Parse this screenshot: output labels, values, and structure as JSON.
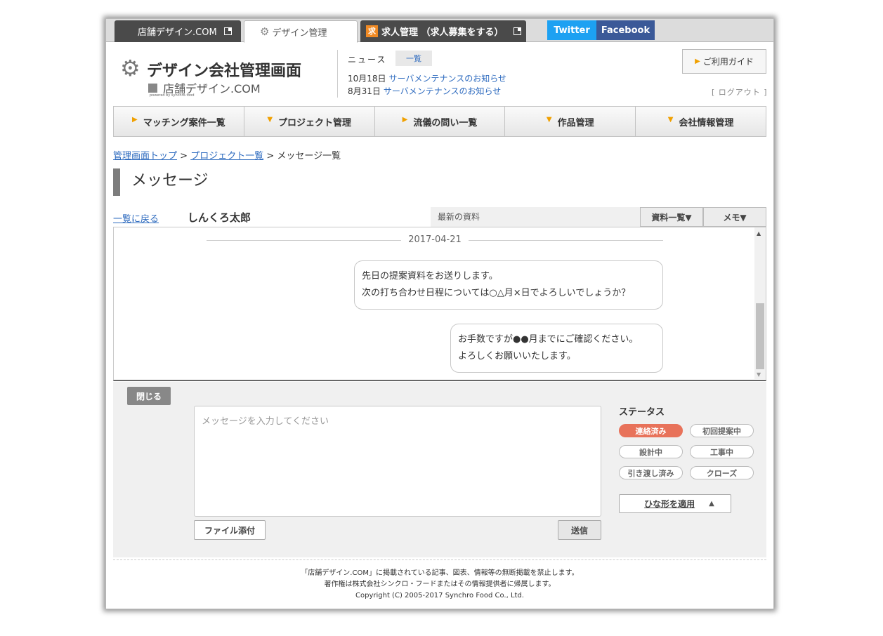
{
  "tabs": [
    {
      "label": "店舗デザイン.COM"
    },
    {
      "label": "デザイン管理"
    },
    {
      "label": "求人管理 （求人募集をする）",
      "badge": "求"
    }
  ],
  "social": {
    "twitter": "Twitter",
    "facebook": "Facebook"
  },
  "header": {
    "title": "デザイン会社管理画面",
    "sub_logo": "店舗デザイン.COM",
    "powered": "powered by synchro-food",
    "news_label": "ニュース",
    "news_list_btn": "一覧",
    "news": [
      {
        "date": "10月18日",
        "title": "サーバメンテナンスのお知らせ"
      },
      {
        "date": "8月31日",
        "title": "サーバメンテナンスのお知らせ"
      }
    ],
    "guide": "ご利用ガイド",
    "logout": "[ ログアウト ]"
  },
  "nav": [
    {
      "label": "マッチング案件一覧"
    },
    {
      "label": "プロジェクト管理"
    },
    {
      "label": "流儀の問い一覧"
    },
    {
      "label": "作品管理"
    },
    {
      "label": "会社情報管理"
    }
  ],
  "breadcrumb": {
    "home": "管理画面トップ",
    "project": "プロジェクト一覧",
    "sep": ">",
    "current": "メッセージ一覧"
  },
  "page_title": "メッセージ",
  "message_header": {
    "back": "一覧に戻る",
    "partner": "しんくろ太郎",
    "latest_docs": "最新の資料",
    "docs_btn": "資料一覧▼",
    "memo_btn": "メモ▼"
  },
  "thread": {
    "date": "2017-04-21",
    "messages": [
      {
        "line1": "先日の提案資料をお送りします。",
        "line2": "次の打ち合わせ日程については○△月×日でよろしいでしょうか？"
      },
      {
        "line1": "お手数ですが●●月までにご確認ください。",
        "line2": "よろしくお願いいたします。"
      }
    ]
  },
  "compose": {
    "close": "閉じる",
    "placeholder": "メッセージを入力してください",
    "attach": "ファイル添付",
    "send": "送信",
    "status_title": "ステータス",
    "statuses": [
      {
        "label": "連絡済み",
        "active": true
      },
      {
        "label": "初回提案中",
        "active": false
      },
      {
        "label": "設計中",
        "active": false
      },
      {
        "label": "工事中",
        "active": false
      },
      {
        "label": "引き渡し済み",
        "active": false
      },
      {
        "label": "クローズ",
        "active": false
      }
    ],
    "template_btn": "ひな形を適用"
  },
  "footer": {
    "line1": "「店舗デザイン.COM」に掲載されている記事、図表、情報等の無断掲載を禁止します。",
    "line2": "著作権は株式会社シンクロ・フードまたはその情報提供者に帰属します。",
    "line3": "Copyright (C) 2005-2017 Synchro Food Co., Ltd."
  },
  "colors": {
    "accent": "#f0a000",
    "twitter": "#1da1f2",
    "facebook": "#3b5998",
    "status_active": "#e8725a",
    "link": "#2e6bbf"
  }
}
